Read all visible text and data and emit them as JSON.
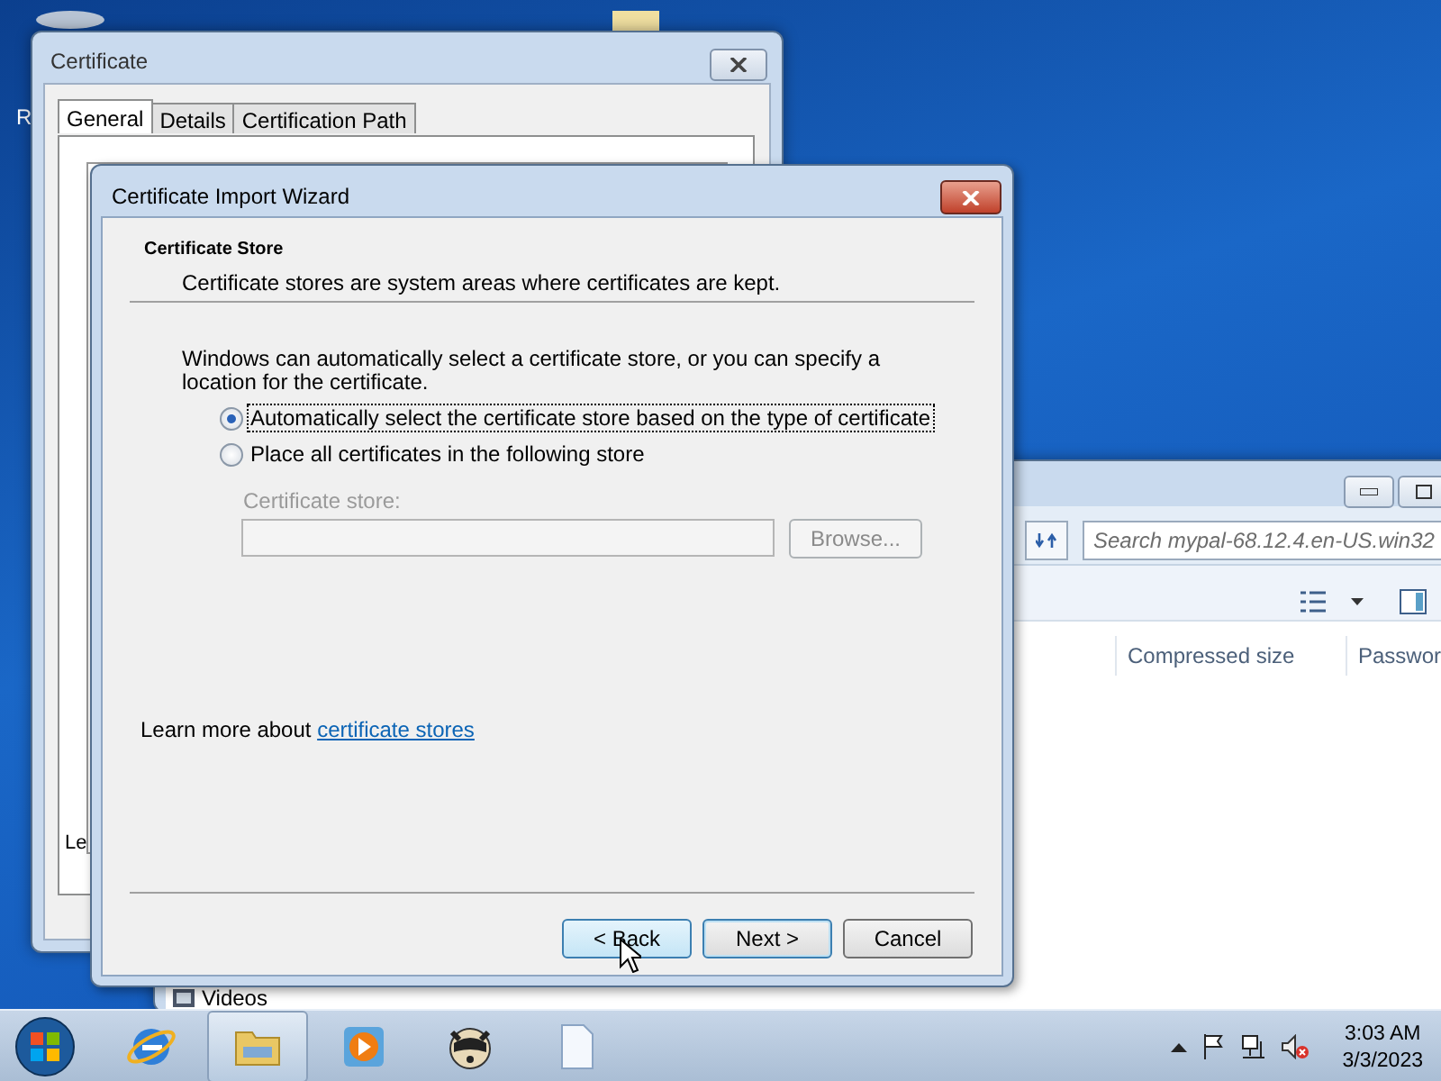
{
  "desktop": {
    "icon_label": "R"
  },
  "explorer": {
    "search": {
      "placeholder": "Search mypal-68.12.4.en-US.win32"
    },
    "columns": [
      "Compressed size",
      "Passwor"
    ],
    "nav_items": [
      "Videos"
    ]
  },
  "certificate_window": {
    "title": "Certificate",
    "tabs": [
      {
        "label": "General",
        "selected": true
      },
      {
        "label": "Details",
        "selected": false
      },
      {
        "label": "Certification Path",
        "selected": false
      }
    ],
    "panel_text": "Le"
  },
  "wizard": {
    "title": "Certificate Import Wizard",
    "heading": "Certificate Store",
    "subheading": "Certificate stores are system areas where certificates are kept.",
    "description": "Windows can automatically select a certificate store, or you can specify a location for the certificate.",
    "options": [
      {
        "label": "Automatically select the certificate store based on the type of certificate",
        "selected": true
      },
      {
        "label": "Place all certificates in the following store",
        "selected": false
      }
    ],
    "store_field": {
      "label": "Certificate store:",
      "disabled": true
    },
    "browse_button": {
      "label": "Browse...",
      "disabled": true
    },
    "learn_more": {
      "text": "Learn more about ",
      "link": "certificate stores"
    },
    "buttons": [
      {
        "label": "< Back",
        "kind": "back"
      },
      {
        "label": "Next >",
        "kind": "next"
      },
      {
        "label": "Cancel",
        "kind": "cancel"
      }
    ]
  },
  "taskbar": {
    "apps": [
      {
        "kind": "ie",
        "selected": false
      },
      {
        "kind": "folder",
        "selected": true
      },
      {
        "kind": "media",
        "selected": false
      },
      {
        "kind": "raccoon",
        "selected": false
      },
      {
        "kind": "document",
        "selected": false
      }
    ],
    "time": "3:03 AM",
    "date": "3/3/2023"
  }
}
